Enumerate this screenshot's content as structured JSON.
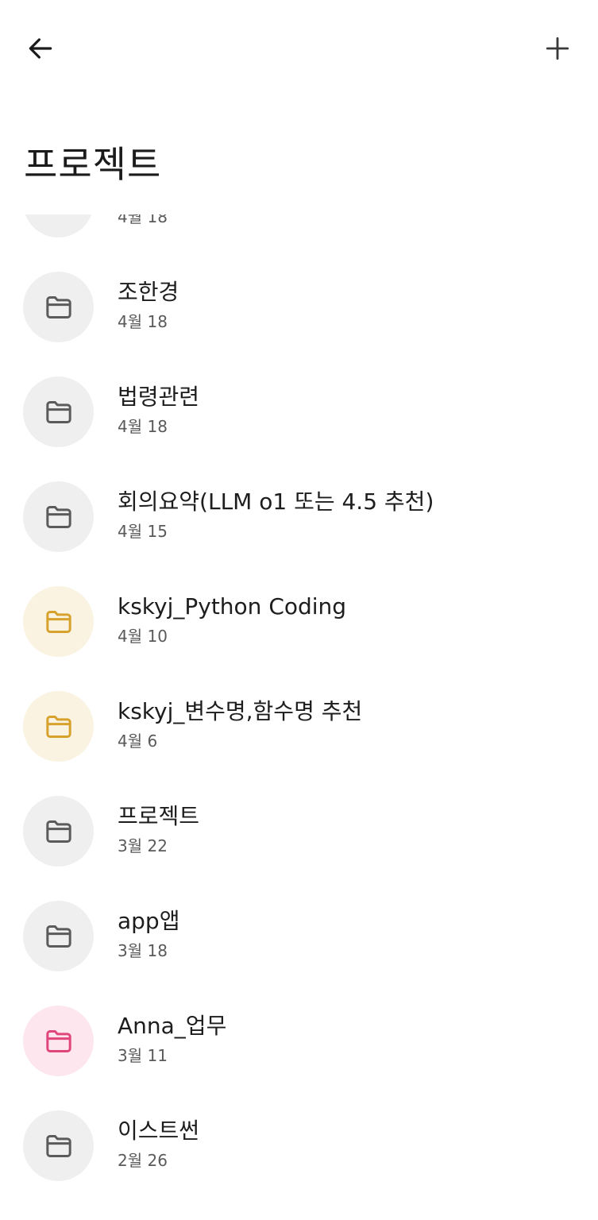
{
  "header": {
    "back_icon": "arrow-left-icon",
    "add_icon": "plus-icon",
    "title": "프로젝트"
  },
  "colors": {
    "neutral_bg": "#efefef",
    "neutral_fg": "#5b5b5b",
    "yellow_bg": "#fbf3e2",
    "yellow_fg": "#d7a22c",
    "pink_bg": "#fde6ee",
    "pink_fg": "#e0457b"
  },
  "projects": [
    {
      "title": "",
      "date": "4월 18",
      "color": "neutral"
    },
    {
      "title": "조한경",
      "date": "4월 18",
      "color": "neutral"
    },
    {
      "title": "법령관련",
      "date": "4월 18",
      "color": "neutral"
    },
    {
      "title": "회의요약(LLM o1 또는 4.5 추천)",
      "date": "4월 15",
      "color": "neutral"
    },
    {
      "title": "kskyj_Python Coding",
      "date": "4월 10",
      "color": "yellow"
    },
    {
      "title": "kskyj_변수명,함수명 추천",
      "date": "4월 6",
      "color": "yellow"
    },
    {
      "title": "프로젝트",
      "date": "3월 22",
      "color": "neutral"
    },
    {
      "title": "app앱",
      "date": "3월 18",
      "color": "neutral"
    },
    {
      "title": "Anna_업무",
      "date": "3월 11",
      "color": "pink"
    },
    {
      "title": "이스트썬",
      "date": "2월 26",
      "color": "neutral"
    }
  ]
}
